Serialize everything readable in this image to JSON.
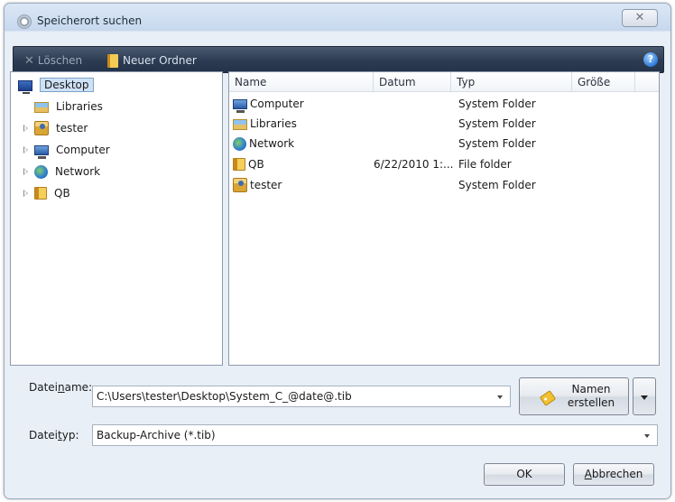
{
  "window": {
    "title": "Speicherort suchen",
    "close_glyph": "✕"
  },
  "toolbar": {
    "delete_label": "Löschen",
    "new_folder_label": "Neuer Ordner",
    "help_glyph": "?"
  },
  "tree": {
    "items": [
      {
        "label": "Desktop",
        "icon": "desktop-icon",
        "selected": true,
        "expandable": false
      },
      {
        "label": "Libraries",
        "icon": "libraries-icon",
        "expandable": false
      },
      {
        "label": "tester",
        "icon": "user-folder-icon",
        "expandable": true
      },
      {
        "label": "Computer",
        "icon": "computer-icon",
        "expandable": true
      },
      {
        "label": "Network",
        "icon": "network-icon",
        "expandable": true
      },
      {
        "label": "QB",
        "icon": "folder-icon",
        "expandable": true
      }
    ]
  },
  "list": {
    "columns": [
      "Name",
      "Datum",
      "Typ",
      "Größe"
    ],
    "rows": [
      {
        "name": "Computer",
        "date": "",
        "type": "System Folder",
        "size": "",
        "icon": "computer-icon"
      },
      {
        "name": "Libraries",
        "date": "",
        "type": "System Folder",
        "size": "",
        "icon": "libraries-icon"
      },
      {
        "name": "Network",
        "date": "",
        "type": "System Folder",
        "size": "",
        "icon": "network-icon"
      },
      {
        "name": "QB",
        "date": "6/22/2010 1:...",
        "type": "File folder",
        "size": "",
        "icon": "folder-icon"
      },
      {
        "name": "tester",
        "date": "",
        "type": "System Folder",
        "size": "",
        "icon": "user-folder-icon"
      }
    ]
  },
  "form": {
    "filename_label_pre": "Datei",
    "filename_label_ul": "n",
    "filename_label_post": "ame:",
    "filename_value": "C:\\Users\\tester\\Desktop\\System_C_@date@.tib",
    "filetype_label_pre": "Datei",
    "filetype_label_ul": "t",
    "filetype_label_post": "yp:",
    "filetype_value": "Backup-Archive (*.tib)",
    "name_button_line1": "Namen",
    "name_button_line2": "erstellen"
  },
  "buttons": {
    "ok_label": "OK",
    "cancel_label_ul": "A",
    "cancel_label_rest": "bbrechen"
  }
}
